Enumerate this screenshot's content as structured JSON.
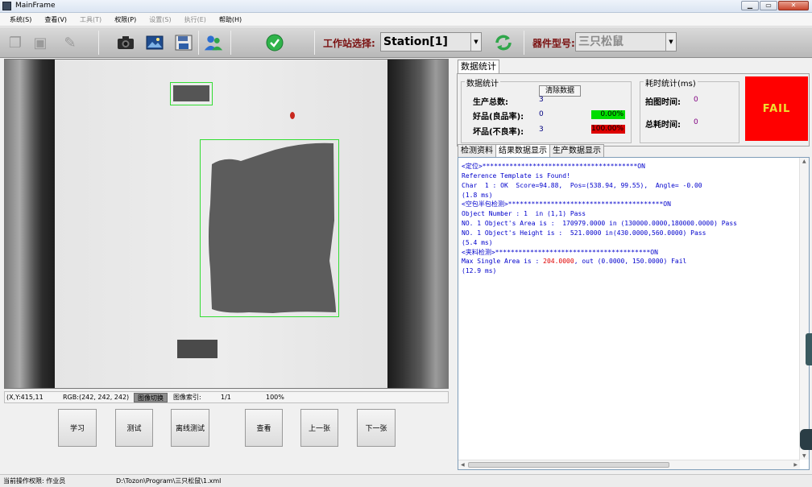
{
  "window": {
    "title": "MainFrame",
    "minimize": "▁",
    "maximize": "▭",
    "close": "✕"
  },
  "menu": [
    {
      "label": "系统(S)",
      "enabled": true
    },
    {
      "label": "查看(V)",
      "enabled": true
    },
    {
      "label": "工具(T)",
      "enabled": false
    },
    {
      "label": "权限(P)",
      "enabled": true
    },
    {
      "label": "设置(S)",
      "enabled": false
    },
    {
      "label": "执行(E)",
      "enabled": false
    },
    {
      "label": "帮助(H)",
      "enabled": true
    }
  ],
  "toolbar": {
    "station_label": "工作站选择:",
    "station_value": "Station[1]",
    "part_label": "器件型号:",
    "part_value": "三只松鼠",
    "icons": [
      "copy-icon",
      "save-icon",
      "edit-icon",
      "camera-icon",
      "image-icon",
      "save-image-icon",
      "users-icon",
      "check-icon",
      "refresh-icon"
    ]
  },
  "image_status": {
    "coords": "(X,Y:415,11",
    "rgb": "RGB:(242, 242, 242)",
    "switch": "图像切换",
    "index_label": "图像索引:",
    "index_value": "1/1",
    "zoom": "100%"
  },
  "buttons": [
    "学习",
    "测试",
    "离线测试",
    "查看",
    "上一张",
    "下一张"
  ],
  "stats_tab": "数据统计",
  "stats": {
    "group_title": "数据统计",
    "clear_button": "清除数据",
    "total_label": "生产总数:",
    "total_value": "3",
    "good_label": "好品(良品率):",
    "good_value": "0",
    "good_pct": "0.00%",
    "bad_label": "坏品(不良率):",
    "bad_value": "3",
    "bad_pct": "100.00%",
    "good_color": "#00dd00",
    "bad_color": "#dd0000"
  },
  "timing": {
    "group_title": "耗时统计(ms)",
    "capture_label": "拍图时间:",
    "capture_value": "0",
    "total_label": "总耗时间:",
    "total_value": "0"
  },
  "result": {
    "label": "FAIL",
    "color": "#ff0000"
  },
  "tabs": [
    "检测资料",
    "结果数据显示",
    "生产数据显示"
  ],
  "log": [
    "<定位>****************************************ON",
    "Reference Template is Found!",
    "Char  1 : OK  Score=94.88,  Pos=(538.94, 99.55),  Angle= -0.00",
    "(1.8 ms)",
    "<空包半包检测>****************************************ON",
    "Object Number : 1  in (1,1) Pass",
    "NO. 1 Object's Area is :  170979.0000 in (130000.0000,180000.0000) Pass",
    "NO. 1 Object's Height is :  521.0000 in(430.0000,560.0000) Pass",
    "(5.4 ms)",
    "<夹料检测>****************************************ON",
    {
      "pre": "Max Single Area is : ",
      "red": "204.0000",
      "post": ", out (0.0000, 150.0000) Fail"
    },
    "(12.9 ms)"
  ],
  "status_bar": {
    "permission": "当前操作权限:  作业员",
    "path": "D:\\Tozon\\Program\\三只松鼠\\1.xml"
  }
}
